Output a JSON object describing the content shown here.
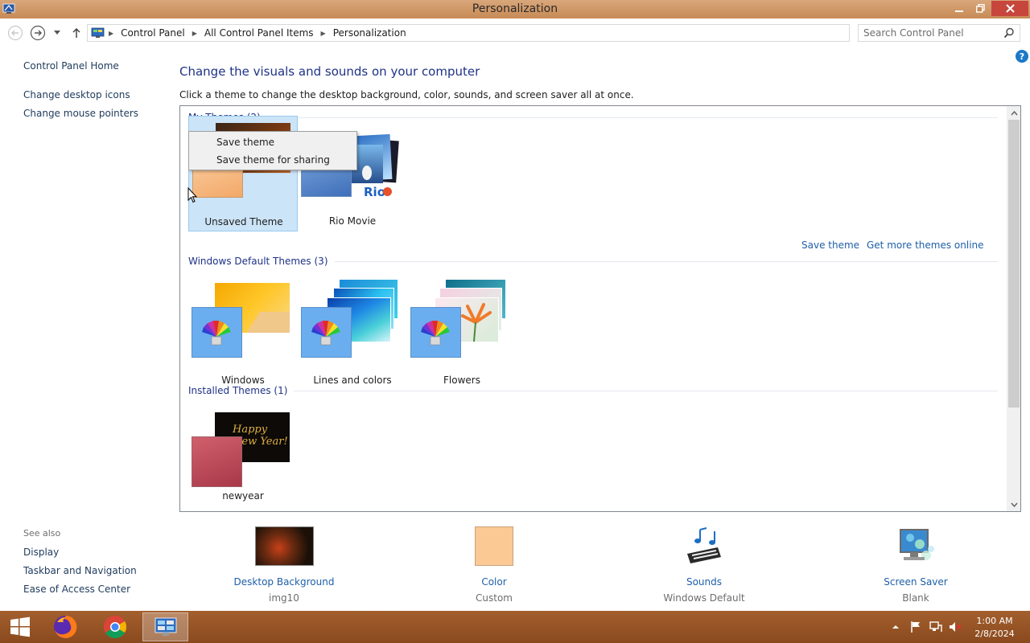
{
  "window": {
    "title": "Personalization"
  },
  "address": {
    "crumbs": [
      "Control Panel",
      "All Control Panel Items",
      "Personalization"
    ],
    "search_placeholder": "Search Control Panel"
  },
  "left_pane": {
    "home": "Control Panel Home",
    "links": [
      "Change desktop icons",
      "Change mouse pointers"
    ],
    "see_also_title": "See also",
    "see_also": [
      "Display",
      "Taskbar and Navigation",
      "Ease of Access Center"
    ]
  },
  "main": {
    "title": "Change the visuals and sounds on your computer",
    "subtitle": "Click a theme to change the desktop background, color, sounds, and screen saver all at once."
  },
  "groups": {
    "my_themes": "My Themes (2)",
    "default_themes": "Windows Default Themes (3)",
    "installed_themes": "Installed Themes (1)"
  },
  "themes": {
    "unsaved": "Unsaved Theme",
    "rio": "Rio Movie",
    "windows": "Windows",
    "lines": "Lines and colors",
    "flowers": "Flowers",
    "newyear": "newyear"
  },
  "thumb_text": {
    "newyear": "Happy New Year!",
    "rio": "Rio"
  },
  "panel_links": {
    "save_theme": "Save theme",
    "get_more": "Get more themes online"
  },
  "context_menu": {
    "items": [
      "Save theme",
      "Save theme for sharing"
    ]
  },
  "bottom": {
    "background": {
      "title": "Desktop Background",
      "value": "img10"
    },
    "color": {
      "title": "Color",
      "value": "Custom",
      "swatch": "#fbc994"
    },
    "sounds": {
      "title": "Sounds",
      "value": "Windows Default"
    },
    "screensaver": {
      "title": "Screen Saver",
      "value": "Blank"
    }
  },
  "taskbar": {
    "time": "1:00 AM",
    "date": "2/8/2024"
  },
  "colors": {
    "accent_title": "#1e3287",
    "link": "#1e5fa8",
    "taskbar": "#8a4a1e",
    "selection": "#cce4f7"
  }
}
